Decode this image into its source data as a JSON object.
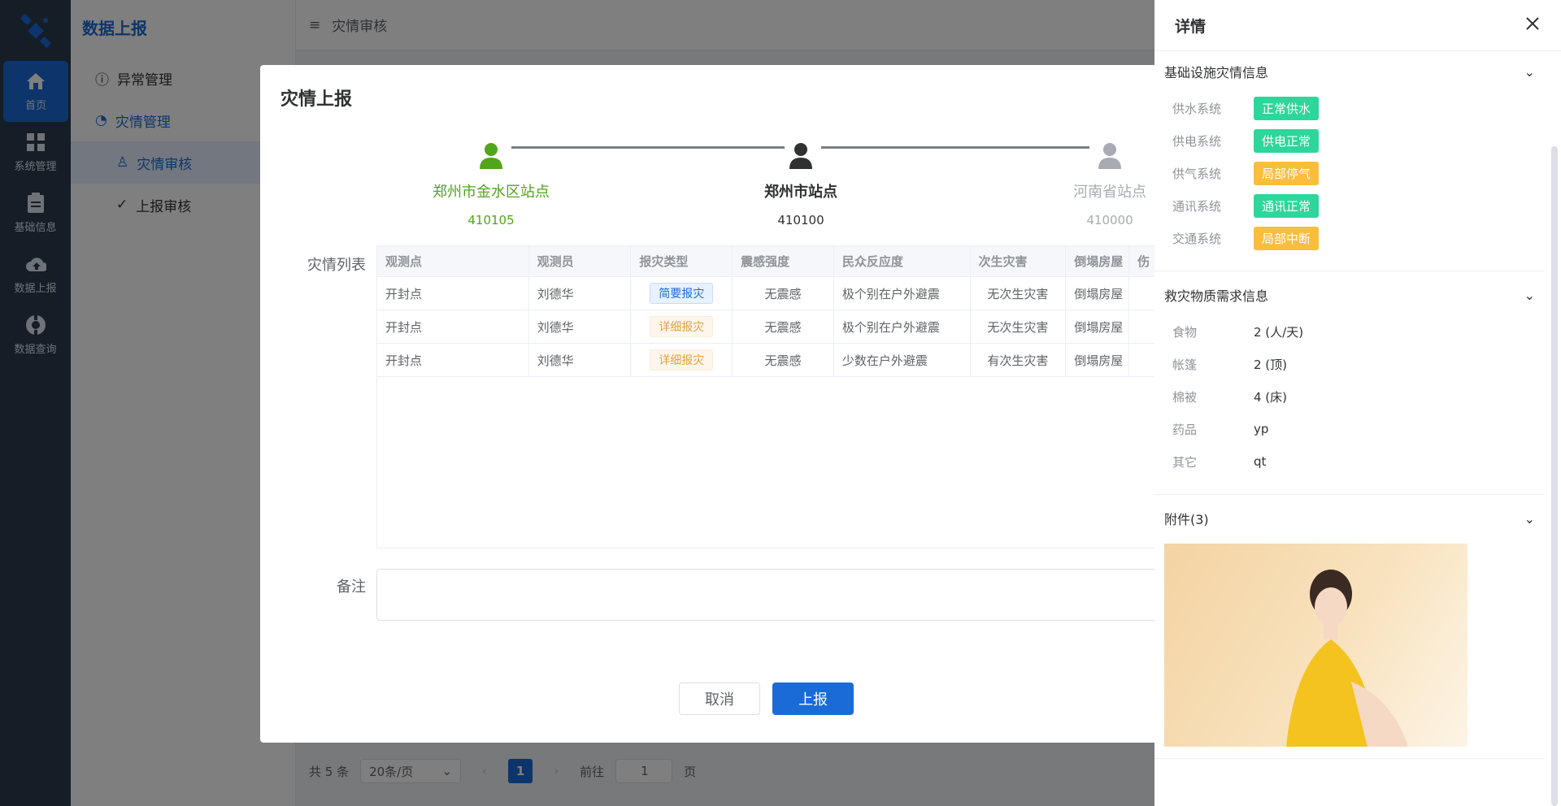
{
  "rail": {
    "items": [
      {
        "label": "首页"
      },
      {
        "label": "系统管理"
      },
      {
        "label": "基础信息"
      },
      {
        "label": "数据上报"
      },
      {
        "label": "数据查询"
      }
    ]
  },
  "submenu": {
    "title": "数据上报",
    "items": [
      {
        "label": "异常管理"
      },
      {
        "label": "灾情管理"
      },
      {
        "label": "灾情审核"
      },
      {
        "label": "上报审核"
      }
    ]
  },
  "topbar": {
    "breadcrumb": "灾情审核"
  },
  "pager": {
    "total": "共 5 条",
    "size": "20条/页",
    "page": "1",
    "goto_label": "前往",
    "goto_value": "1",
    "page_suffix": "页"
  },
  "dialog": {
    "title": "灾情上报",
    "steps": [
      {
        "name": "郑州市金水区站点",
        "code": "410105"
      },
      {
        "name": "郑州市站点",
        "code": "410100"
      },
      {
        "name": "河南省站点",
        "code": "410000"
      }
    ],
    "list_label": "灾情列表",
    "columns": [
      "观测点",
      "观测员",
      "报灾类型",
      "震感强度",
      "民众反应度",
      "次生灾害",
      "倒塌房屋",
      "伤"
    ],
    "rows": [
      {
        "point": "开封点",
        "observer": "刘德华",
        "type": "简要报灾",
        "type_style": "blue",
        "intensity": "无震感",
        "reaction": "极个别在户外避震",
        "secondary": "无次生灾害",
        "collapse": "倒塌房屋"
      },
      {
        "point": "开封点",
        "observer": "刘德华",
        "type": "详细报灾",
        "type_style": "orange",
        "intensity": "无震感",
        "reaction": "极个别在户外避震",
        "secondary": "无次生灾害",
        "collapse": "倒塌房屋"
      },
      {
        "point": "开封点",
        "observer": "刘德华",
        "type": "详细报灾",
        "type_style": "orange",
        "intensity": "无震感",
        "reaction": "少数在户外避震",
        "secondary": "有次生灾害",
        "collapse": "倒塌房屋"
      }
    ],
    "remark_label": "备注",
    "cancel_label": "取消",
    "submit_label": "上报"
  },
  "drawer": {
    "title": "详情",
    "infra": {
      "title": "基础设施灾情信息",
      "items": [
        {
          "k": "供水系统",
          "v": "正常供水",
          "color": "green"
        },
        {
          "k": "供电系统",
          "v": "供电正常",
          "color": "green"
        },
        {
          "k": "供气系统",
          "v": "局部停气",
          "color": "orange"
        },
        {
          "k": "通讯系统",
          "v": "通讯正常",
          "color": "green"
        },
        {
          "k": "交通系统",
          "v": "局部中断",
          "color": "orange"
        }
      ]
    },
    "supplies": {
      "title": "救灾物质需求信息",
      "items": [
        {
          "k": "食物",
          "v": "2 (人/天)"
        },
        {
          "k": "帐篷",
          "v": "2 (顶)"
        },
        {
          "k": "棉被",
          "v": "4 (床)"
        },
        {
          "k": "药品",
          "v": "yp"
        },
        {
          "k": "其它",
          "v": "qt"
        }
      ]
    },
    "attachments": {
      "title": "附件(3)"
    }
  },
  "colors": {
    "primary": "#1a6bd6",
    "success_green": "#52a41c",
    "badge_green": "#2dd69a",
    "badge_orange": "#fbbd3c"
  }
}
